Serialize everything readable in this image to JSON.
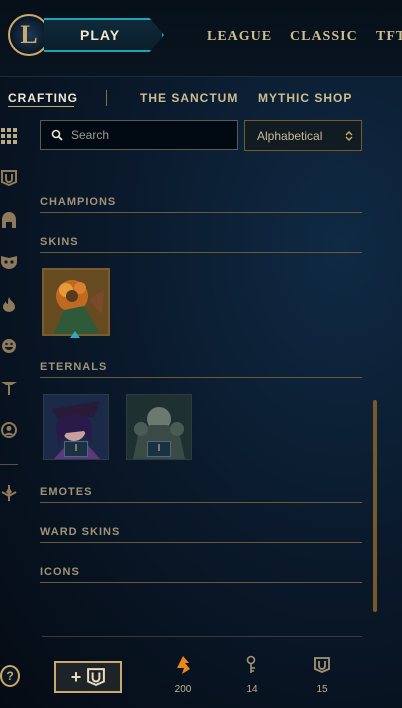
{
  "topbar": {
    "logo_letter": "L",
    "play_label": "PLAY",
    "nav": [
      "LEAGUE",
      "CLASSIC",
      "TFT"
    ]
  },
  "subnav": {
    "items": [
      "CRAFTING",
      "THE SANCTUM",
      "MYTHIC SHOP"
    ],
    "active": "CRAFTING"
  },
  "sidebar": {
    "icons": [
      "grid-icon",
      "chest-icon",
      "helmet-icon",
      "mask-icon",
      "fire-icon",
      "emote-face-icon",
      "totem-icon",
      "profile-icon",
      "ward-icon"
    ]
  },
  "search": {
    "placeholder": "Search"
  },
  "sort": {
    "selected": "Alphabetical"
  },
  "sections": {
    "champions": "CHAMPIONS",
    "skins": "SKINS",
    "eternals": "ETERNALS",
    "emotes": "EMOTES",
    "ward_skins": "WARD SKINS",
    "icons": "ICONS"
  },
  "eternals": [
    {
      "level": "I"
    },
    {
      "level": "I"
    }
  ],
  "footer": {
    "craft_plus": "+",
    "help": "?",
    "currencies": [
      {
        "icon": "orange-essence-icon",
        "value": "200"
      },
      {
        "icon": "key-icon",
        "value": "14"
      },
      {
        "icon": "chest-icon",
        "value": "15"
      }
    ]
  },
  "colors": {
    "gold": "#c8aa6e",
    "teal": "#1ba5b8",
    "bg": "#0a1a2c"
  }
}
